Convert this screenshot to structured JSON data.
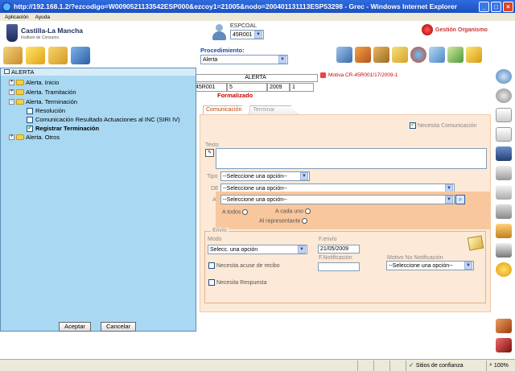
{
  "window": {
    "title": "http://192.168.1.2/?ezcodigo=W0090521133542ESP000&ezcoy1=21005&nodo=200401131113ESP53298 - Grec - Windows Internet Explorer"
  },
  "menu": [
    "Aplicación",
    "Ayuda"
  ],
  "header": {
    "logo_name": "Castilla-La Mancha",
    "logo_sub": "Instituto de Consumo",
    "user_label": "ESPCOAL",
    "user_select": "45R001",
    "org_label": "Gestión Organismo",
    "procedimiento_label": "Procedimiento:",
    "procedimiento_value": "Alerta"
  },
  "alerta": {
    "title": "ALERTA",
    "cells": [
      "45R001",
      "5",
      "2009",
      "1"
    ],
    "status": "Formalizado",
    "motiva": "Motiva CR-45R001/17/2009-1"
  },
  "tabs": [
    "Comunicación",
    "Terminar"
  ],
  "form": {
    "necesita_comunicacion": "Necesita Comunicación",
    "texto_label": "Texto",
    "tipo_label": "Tipo",
    "tipo_value": "--Seleccione una opción--",
    "de_label": "DE",
    "de_value": "--Seleccione una opción--",
    "a_label": "A",
    "a_value": "--Seleccione una opción--",
    "a_todos": "A todos",
    "a_cada_uno": "A cada uno",
    "al_representante": "Al representante",
    "envio_legend": "Envío",
    "modo_label": "Modo",
    "modo_value": "Selecc. una opción",
    "fenvio_label": "F.envío",
    "fenvio_value": "21/05/2009",
    "fnotificacion_label": "F.Notificación",
    "motivo_label": "Motivo No Notificación",
    "motivo_value": "--Seleccione una opción--",
    "acuse_label": "Necesita acuse de recibo",
    "respuesta_label": "Necesita Respuesta"
  },
  "tree": {
    "root": "ALERTA",
    "items": [
      {
        "label": "Alerta. Inicio"
      },
      {
        "label": "Alerta. Tramitación"
      },
      {
        "label": "Alerta. Terminación"
      },
      {
        "label": "Resolución"
      },
      {
        "label": "Comunicación Resultado Actuaciones al INC (SIRI IV)"
      },
      {
        "label": "Registrar Terminación"
      },
      {
        "label": "Alerta. Otros"
      }
    ],
    "accept": "Aceptar",
    "cancel": "Cancelar"
  },
  "status": {
    "zone": "Sitios de confianza",
    "zoom": "100%"
  },
  "colors": {
    "accent": "#1d47a8",
    "panel": "#fde9d7",
    "tree_bg": "#a9d8f2",
    "alert_red": "#cc0000"
  }
}
